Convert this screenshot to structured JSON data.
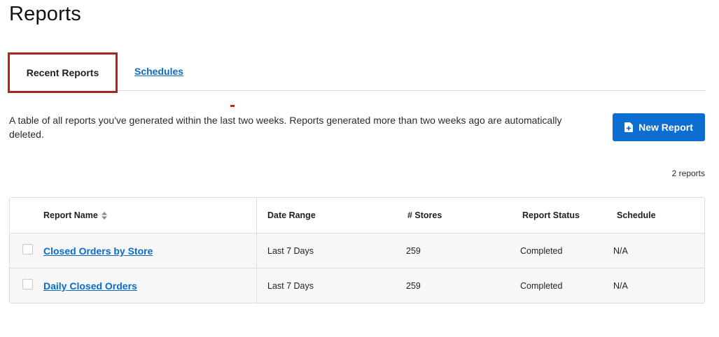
{
  "page": {
    "title": "Reports"
  },
  "tabs": [
    {
      "label": "Recent Reports",
      "active": true
    },
    {
      "label": "Schedules",
      "active": false
    }
  ],
  "description": "A table of all reports you've generated within the last two weeks. Reports generated more than two weeks ago are automatically deleted.",
  "actions": {
    "new_report_label": "New Report",
    "new_report_icon": "doc-plus-icon"
  },
  "count_text": "2 reports",
  "table": {
    "columns": [
      "Report Name",
      "Date Range",
      "# Stores",
      "Report Status",
      "Schedule"
    ],
    "rows": [
      {
        "name": "Closed Orders by Store",
        "date_range": "Last 7 Days",
        "stores": "259",
        "status": "Completed",
        "schedule": "N/A"
      },
      {
        "name": "Daily Closed Orders",
        "date_range": "Last 7 Days",
        "stores": "259",
        "status": "Completed",
        "schedule": "N/A"
      }
    ]
  },
  "colors": {
    "accent_blue": "#0b6ed0",
    "active_tab_border": "#a8281e",
    "link": "#0a6cc4"
  }
}
